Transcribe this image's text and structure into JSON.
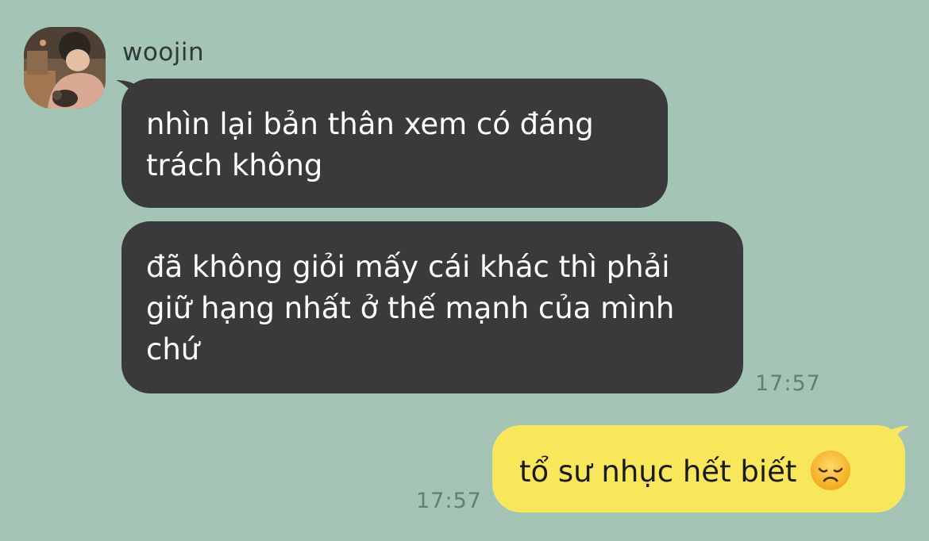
{
  "conversation": {
    "sender_name": "woojin",
    "messages": [
      {
        "direction": "incoming",
        "text": "nhìn lại bản thân xem có đáng trách không"
      },
      {
        "direction": "incoming",
        "text": "đã không giỏi mấy cái khác thì phải giữ hạng nhất ở thế mạnh của mình chứ",
        "time": "17:57"
      },
      {
        "direction": "outgoing",
        "text": "tổ sư nhục hết biết",
        "emoji": "disappointed-face",
        "time": "17:57"
      }
    ]
  },
  "colors": {
    "background": "#a4c5b6",
    "incoming_bubble": "#3a3a3c",
    "outgoing_bubble": "#f9e75b",
    "timestamp": "#687c73"
  }
}
